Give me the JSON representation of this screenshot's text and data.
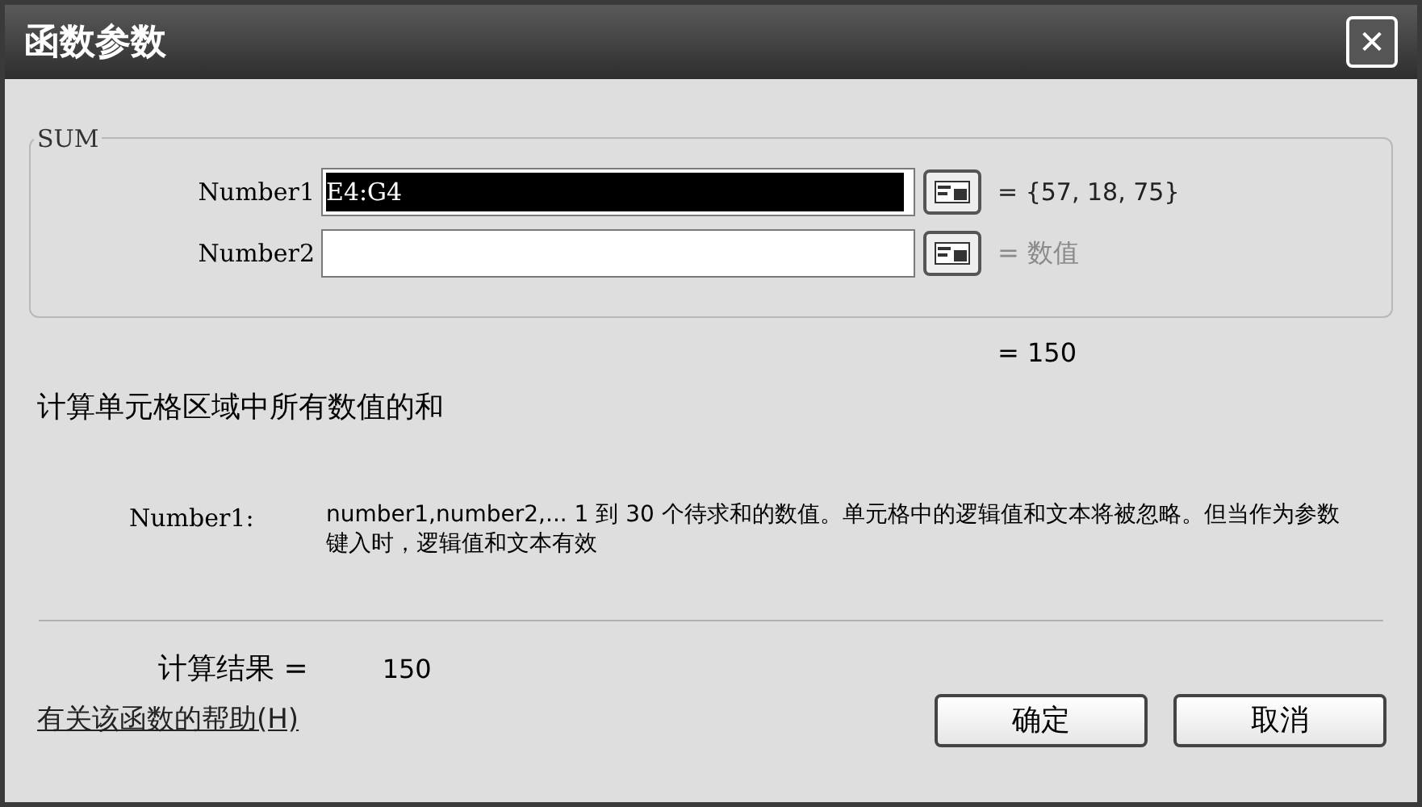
{
  "window": {
    "title": "函数参数",
    "close": "✕"
  },
  "group": {
    "title": "SUM"
  },
  "arguments": [
    {
      "label": "Number1",
      "value": "E4:G4",
      "selected": true,
      "result": "= {57, 18, 75}",
      "result_muted": false
    },
    {
      "label": "Number2",
      "selected": false,
      "result": "= 数值",
      "result_muted": true
    }
  ],
  "formula_result": "= 150",
  "description": "计算单元格区域中所有数值的和",
  "argument_help": {
    "label": "Number1:",
    "text": "number1,number2,... 1 到 30 个待求和的数值。单元格中的逻辑值和文本将被忽略。但当作为参数键入时，逻辑值和文本有效"
  },
  "result": {
    "label": "计算结果 =",
    "value": "150"
  },
  "help_link": "有关该函数的帮助(H)",
  "buttons": [
    "确定",
    "取消"
  ]
}
